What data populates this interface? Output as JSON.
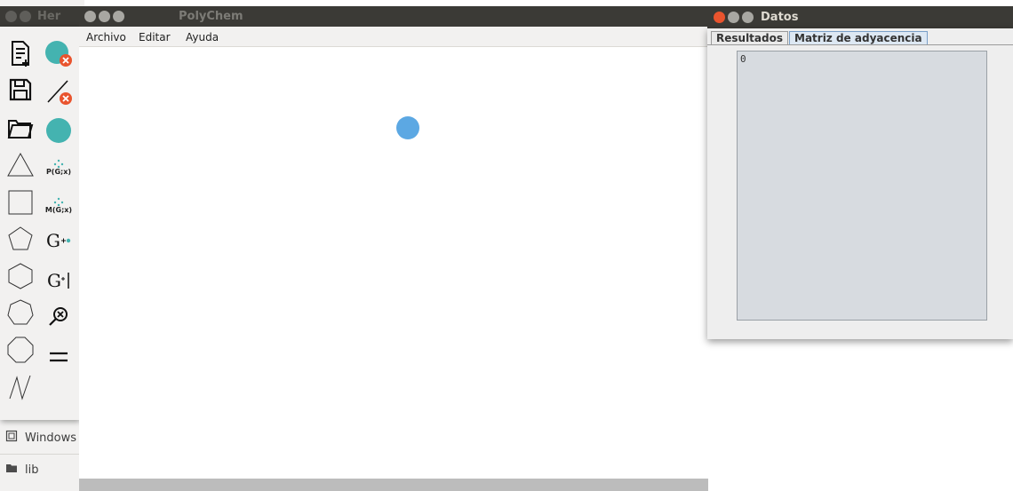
{
  "desktop": {
    "file_items": [
      {
        "label": "Windows",
        "icon": "document-icon"
      },
      {
        "label": "lib",
        "icon": "folder-icon"
      }
    ]
  },
  "tools_window": {
    "title": "Her"
  },
  "polychem": {
    "title": "PolyChem",
    "menu": [
      "Archivo",
      "Editar",
      "Ayuda"
    ]
  },
  "tool_labels": {
    "poly_graph": "P(G;x)",
    "matching_graph": "M(G;x)",
    "g_plus_vertex": "G",
    "g_plus_edge": "G"
  },
  "datos": {
    "title": "Datos",
    "tabs": [
      "Resultados",
      "Matriz de adyacencia"
    ],
    "active_tab": "Matriz de adyacencia",
    "matrix_text": "0"
  },
  "colors": {
    "vertex": "#5ca8e3",
    "teal": "#44b3b0",
    "close": "#e9542e",
    "titlebar": "#3b3a36"
  }
}
